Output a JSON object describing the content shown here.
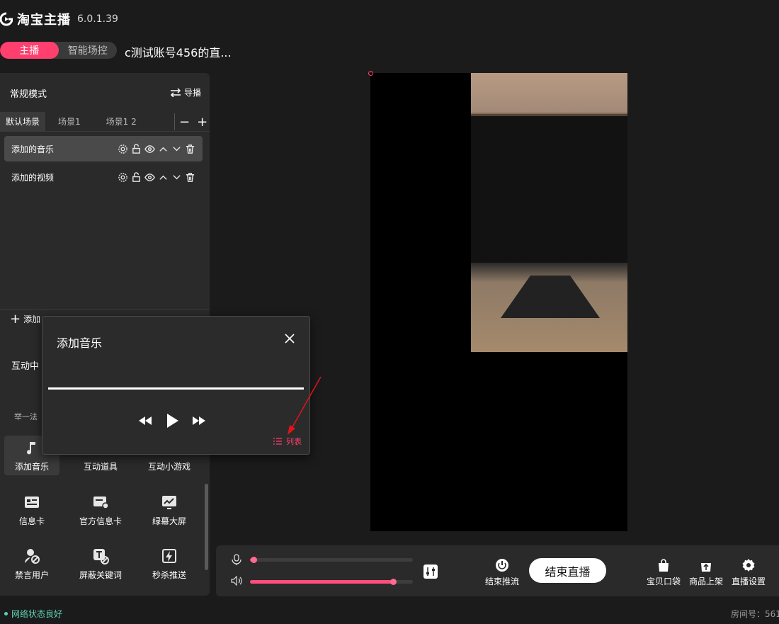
{
  "header": {
    "app_name": "淘宝主播",
    "version": "6.0.1.39",
    "modes": [
      "主播",
      "智能场控"
    ],
    "account": "c测试账号456的直..."
  },
  "panel": {
    "mode_title": "常规模式",
    "guide_label": "导播",
    "scene_tabs": [
      "默认场景",
      "场景1",
      "场景1 2"
    ],
    "sources": [
      {
        "label": "添加的音乐"
      },
      {
        "label": "添加的视频"
      }
    ],
    "add_label": "添加",
    "interactive_label": "互动中",
    "partial_text": "举一法",
    "grid": [
      {
        "label": "添加音乐",
        "icon": "music-icon"
      },
      {
        "label": "互动道具",
        "icon": "props-icon"
      },
      {
        "label": "互动小游戏",
        "icon": "game-icon"
      },
      {
        "label": "信息卡",
        "icon": "info-card-icon"
      },
      {
        "label": "官方信息卡",
        "icon": "official-card-icon"
      },
      {
        "label": "绿幕大屏",
        "icon": "green-screen-icon"
      },
      {
        "label": "禁言用户",
        "icon": "mute-user-icon"
      },
      {
        "label": "屏蔽关键词",
        "icon": "block-keyword-icon"
      },
      {
        "label": "秒杀推送",
        "icon": "flash-sale-icon"
      }
    ]
  },
  "popup": {
    "title": "添加音乐",
    "list_label": "列表",
    "progress": 1.0
  },
  "bottom": {
    "mic_level": 0.02,
    "speaker_level": 0.88,
    "stop_push_label": "结束推流",
    "end_live_label": "结束直播",
    "bag_label": "宝贝口袋",
    "shelf_label": "商品上架",
    "settings_label": "直播设置"
  },
  "status": {
    "network": "网络状态良好",
    "room": "房间号：561"
  },
  "colors": {
    "accent": "#ff3f6e",
    "background": "#1b1b1b",
    "panel": "#2a2a2a",
    "network_ok": "#5fd0b0"
  }
}
